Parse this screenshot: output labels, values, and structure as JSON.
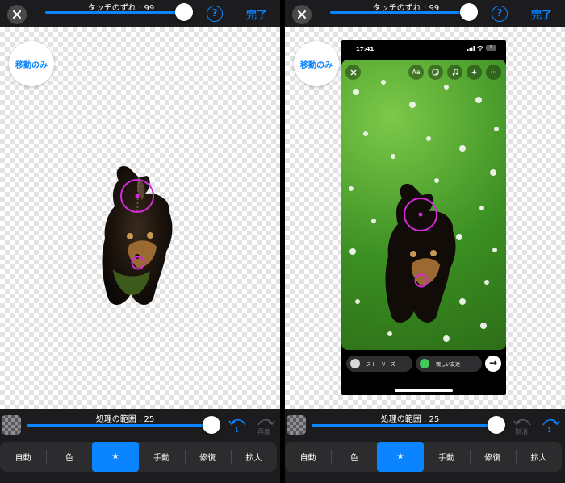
{
  "header": {
    "offset_label": "タッチのずれ : 99",
    "offset_value": 99,
    "help_label": "?",
    "done_label": "完了"
  },
  "canvas": {
    "move_only_label": "移動のみ"
  },
  "bottom": {
    "range_label": "処理の範囲 : 25",
    "range_value": 25,
    "undo_count": "1",
    "redo_label": "再度",
    "cancel_label": "取消",
    "redo_count": "1"
  },
  "modes": [
    {
      "label": "自動"
    },
    {
      "label": "色"
    },
    {
      "label": "★",
      "active": true
    },
    {
      "label": "手動"
    },
    {
      "label": "修復"
    },
    {
      "label": "拡大"
    }
  ],
  "preview": {
    "time": "17:41",
    "battery": "9",
    "text_tool": "Aa",
    "more": "···",
    "stories_label": "ストーリーズ",
    "close_friends_label": "親しい友達",
    "send": "→"
  },
  "colors": {
    "accent": "#0a84ff",
    "toolbar_bg": "#1c1c1e",
    "brush_ring": "#d52bd8",
    "close_friends": "#3fcb5a"
  }
}
